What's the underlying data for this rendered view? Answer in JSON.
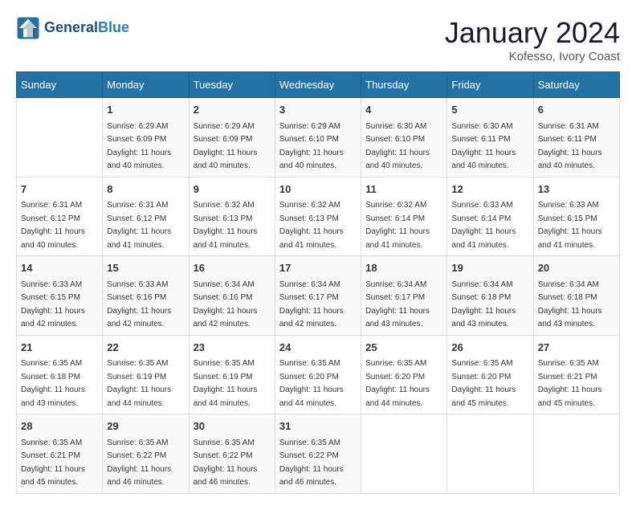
{
  "header": {
    "logo_line1": "General",
    "logo_line2": "Blue",
    "month_title": "January 2024",
    "location": "Kofesso, Ivory Coast"
  },
  "days_of_week": [
    "Sunday",
    "Monday",
    "Tuesday",
    "Wednesday",
    "Thursday",
    "Friday",
    "Saturday"
  ],
  "weeks": [
    [
      {
        "day": "",
        "sunrise": "",
        "sunset": "",
        "daylight": ""
      },
      {
        "day": "1",
        "sunrise": "Sunrise: 6:29 AM",
        "sunset": "Sunset: 6:09 PM",
        "daylight": "Daylight: 11 hours and 40 minutes."
      },
      {
        "day": "2",
        "sunrise": "Sunrise: 6:29 AM",
        "sunset": "Sunset: 6:09 PM",
        "daylight": "Daylight: 11 hours and 40 minutes."
      },
      {
        "day": "3",
        "sunrise": "Sunrise: 6:29 AM",
        "sunset": "Sunset: 6:10 PM",
        "daylight": "Daylight: 11 hours and 40 minutes."
      },
      {
        "day": "4",
        "sunrise": "Sunrise: 6:30 AM",
        "sunset": "Sunset: 6:10 PM",
        "daylight": "Daylight: 11 hours and 40 minutes."
      },
      {
        "day": "5",
        "sunrise": "Sunrise: 6:30 AM",
        "sunset": "Sunset: 6:11 PM",
        "daylight": "Daylight: 11 hours and 40 minutes."
      },
      {
        "day": "6",
        "sunrise": "Sunrise: 6:31 AM",
        "sunset": "Sunset: 6:11 PM",
        "daylight": "Daylight: 11 hours and 40 minutes."
      }
    ],
    [
      {
        "day": "7",
        "sunrise": "Sunrise: 6:31 AM",
        "sunset": "Sunset: 6:12 PM",
        "daylight": "Daylight: 11 hours and 40 minutes."
      },
      {
        "day": "8",
        "sunrise": "Sunrise: 6:31 AM",
        "sunset": "Sunset: 6:12 PM",
        "daylight": "Daylight: 11 hours and 41 minutes."
      },
      {
        "day": "9",
        "sunrise": "Sunrise: 6:32 AM",
        "sunset": "Sunset: 6:13 PM",
        "daylight": "Daylight: 11 hours and 41 minutes."
      },
      {
        "day": "10",
        "sunrise": "Sunrise: 6:32 AM",
        "sunset": "Sunset: 6:13 PM",
        "daylight": "Daylight: 11 hours and 41 minutes."
      },
      {
        "day": "11",
        "sunrise": "Sunrise: 6:32 AM",
        "sunset": "Sunset: 6:14 PM",
        "daylight": "Daylight: 11 hours and 41 minutes."
      },
      {
        "day": "12",
        "sunrise": "Sunrise: 6:33 AM",
        "sunset": "Sunset: 6:14 PM",
        "daylight": "Daylight: 11 hours and 41 minutes."
      },
      {
        "day": "13",
        "sunrise": "Sunrise: 6:33 AM",
        "sunset": "Sunset: 6:15 PM",
        "daylight": "Daylight: 11 hours and 41 minutes."
      }
    ],
    [
      {
        "day": "14",
        "sunrise": "Sunrise: 6:33 AM",
        "sunset": "Sunset: 6:15 PM",
        "daylight": "Daylight: 11 hours and 42 minutes."
      },
      {
        "day": "15",
        "sunrise": "Sunrise: 6:33 AM",
        "sunset": "Sunset: 6:16 PM",
        "daylight": "Daylight: 11 hours and 42 minutes."
      },
      {
        "day": "16",
        "sunrise": "Sunrise: 6:34 AM",
        "sunset": "Sunset: 6:16 PM",
        "daylight": "Daylight: 11 hours and 42 minutes."
      },
      {
        "day": "17",
        "sunrise": "Sunrise: 6:34 AM",
        "sunset": "Sunset: 6:17 PM",
        "daylight": "Daylight: 11 hours and 42 minutes."
      },
      {
        "day": "18",
        "sunrise": "Sunrise: 6:34 AM",
        "sunset": "Sunset: 6:17 PM",
        "daylight": "Daylight: 11 hours and 43 minutes."
      },
      {
        "day": "19",
        "sunrise": "Sunrise: 6:34 AM",
        "sunset": "Sunset: 6:18 PM",
        "daylight": "Daylight: 11 hours and 43 minutes."
      },
      {
        "day": "20",
        "sunrise": "Sunrise: 6:34 AM",
        "sunset": "Sunset: 6:18 PM",
        "daylight": "Daylight: 11 hours and 43 minutes."
      }
    ],
    [
      {
        "day": "21",
        "sunrise": "Sunrise: 6:35 AM",
        "sunset": "Sunset: 6:18 PM",
        "daylight": "Daylight: 11 hours and 43 minutes."
      },
      {
        "day": "22",
        "sunrise": "Sunrise: 6:35 AM",
        "sunset": "Sunset: 6:19 PM",
        "daylight": "Daylight: 11 hours and 44 minutes."
      },
      {
        "day": "23",
        "sunrise": "Sunrise: 6:35 AM",
        "sunset": "Sunset: 6:19 PM",
        "daylight": "Daylight: 11 hours and 44 minutes."
      },
      {
        "day": "24",
        "sunrise": "Sunrise: 6:35 AM",
        "sunset": "Sunset: 6:20 PM",
        "daylight": "Daylight: 11 hours and 44 minutes."
      },
      {
        "day": "25",
        "sunrise": "Sunrise: 6:35 AM",
        "sunset": "Sunset: 6:20 PM",
        "daylight": "Daylight: 11 hours and 44 minutes."
      },
      {
        "day": "26",
        "sunrise": "Sunrise: 6:35 AM",
        "sunset": "Sunset: 6:20 PM",
        "daylight": "Daylight: 11 hours and 45 minutes."
      },
      {
        "day": "27",
        "sunrise": "Sunrise: 6:35 AM",
        "sunset": "Sunset: 6:21 PM",
        "daylight": "Daylight: 11 hours and 45 minutes."
      }
    ],
    [
      {
        "day": "28",
        "sunrise": "Sunrise: 6:35 AM",
        "sunset": "Sunset: 6:21 PM",
        "daylight": "Daylight: 11 hours and 45 minutes."
      },
      {
        "day": "29",
        "sunrise": "Sunrise: 6:35 AM",
        "sunset": "Sunset: 6:22 PM",
        "daylight": "Daylight: 11 hours and 46 minutes."
      },
      {
        "day": "30",
        "sunrise": "Sunrise: 6:35 AM",
        "sunset": "Sunset: 6:22 PM",
        "daylight": "Daylight: 11 hours and 46 minutes."
      },
      {
        "day": "31",
        "sunrise": "Sunrise: 6:35 AM",
        "sunset": "Sunset: 6:22 PM",
        "daylight": "Daylight: 11 hours and 46 minutes."
      },
      {
        "day": "",
        "sunrise": "",
        "sunset": "",
        "daylight": ""
      },
      {
        "day": "",
        "sunrise": "",
        "sunset": "",
        "daylight": ""
      },
      {
        "day": "",
        "sunrise": "",
        "sunset": "",
        "daylight": ""
      }
    ]
  ]
}
